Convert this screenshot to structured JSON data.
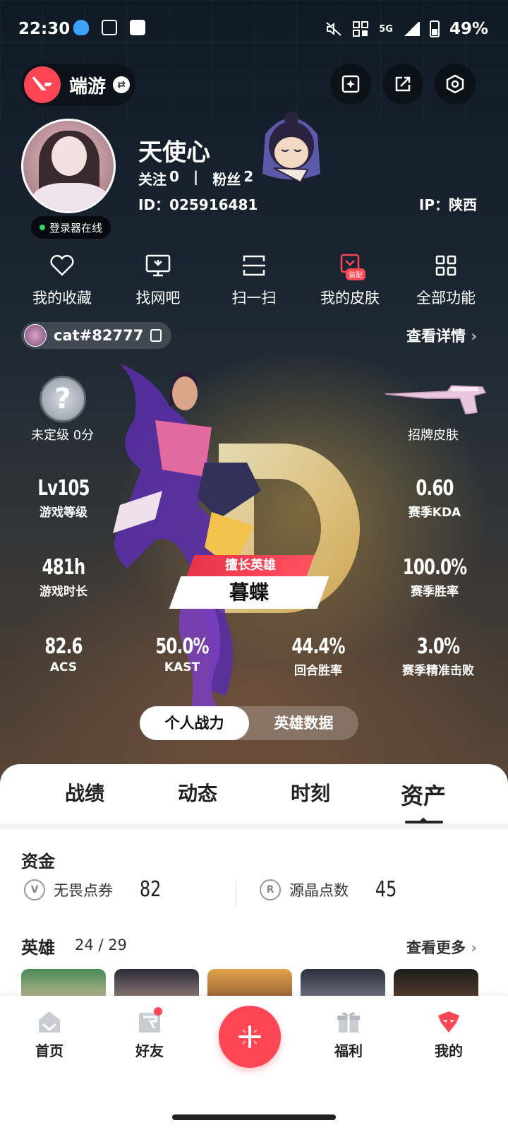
{
  "status": {
    "time": "22:30",
    "network": "5G",
    "battery": "49%"
  },
  "topbar": {
    "game_name": "端游"
  },
  "profile": {
    "nickname": "天使心",
    "follow_label": "关注",
    "follow_count": "0",
    "fans_label": "粉丝",
    "fans_count": "2",
    "id_text": "ID：025916481",
    "ip_text": "IP：陕西",
    "online_text": "登录器在线"
  },
  "menu": [
    {
      "label": "我的收藏",
      "icon": "heart-icon"
    },
    {
      "label": "找网吧",
      "icon": "monitor-icon"
    },
    {
      "label": "扫一扫",
      "icon": "scan-icon"
    },
    {
      "label": "我的皮肤",
      "icon": "skin-icon",
      "badge": "装配"
    },
    {
      "label": "全部功能",
      "icon": "grid-icon"
    }
  ],
  "riot": {
    "riot_id": "cat#82777",
    "detail_link": "查看详情"
  },
  "stats": {
    "rank_text": "未定级 0分",
    "skin_label": "招牌皮肤",
    "level_value": "Lv105",
    "level_label": "游戏等级",
    "kda_value": "0.60",
    "kda_label": "赛季KDA",
    "time_value": "481h",
    "time_label": "游戏时长",
    "winrate_value": "100.0%",
    "winrate_label": "赛季胜率",
    "acs_value": "82.6",
    "acs_label": "ACS",
    "kast_value": "50.0%",
    "kast_label": "KAST",
    "round_value": "44.4%",
    "round_label": "回合胜率",
    "headshot_value": "3.0%",
    "headshot_label": "赛季精准击败",
    "fav_hero_tag": "擅长英雄",
    "fav_hero_name": "暮蝶"
  },
  "toggle": {
    "personal": "个人战力",
    "hero_data": "英雄数据"
  },
  "tabs": [
    "战绩",
    "动态",
    "时刻",
    "资产"
  ],
  "assets": {
    "funds_title": "资金",
    "vp_label": "无畏点券",
    "vp_value": "82",
    "rp_label": "源晶点数",
    "rp_value": "45",
    "heroes_title": "英雄",
    "heroes_count": "24",
    "heroes_total": "29",
    "more_link": "查看更多"
  },
  "nav": {
    "home": "首页",
    "friends": "好友",
    "welfare": "福利",
    "mine": "我的"
  },
  "colors": {
    "accent": "#ff4655",
    "online": "#32d26a"
  }
}
